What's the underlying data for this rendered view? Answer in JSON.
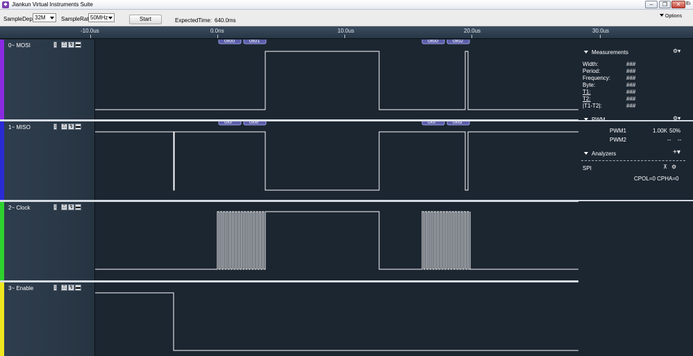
{
  "window": {
    "title": "Jiankun Virtual Instruments Suite",
    "edge_text": "Ei",
    "icon": "app-logo-icon",
    "minimize_glyph": "–",
    "restore_glyph": "❐",
    "close_glyph": "✕"
  },
  "toolbar": {
    "sample_depth_label": "SampleDepth",
    "sample_depth_value": "32M",
    "sample_rate_label": "SampleRate",
    "sample_rate_value": "50MHz",
    "start_label": "Start",
    "expected_time_label": "ExpectedTime:",
    "expected_time_value": "640.0ms",
    "options_label": "Options"
  },
  "ruler": {
    "labels": [
      "-10.0us",
      "0.0ns",
      "10.0us",
      "20.0us",
      "30.0us"
    ]
  },
  "channels": [
    {
      "name": "0~ MOSI",
      "color": "#8a2be2",
      "decodes": [
        "0x00",
        "0x01",
        "0x00",
        "0x02"
      ]
    },
    {
      "name": "1~ MISO",
      "color": "#2b2bd6",
      "decodes": [
        "0xff",
        "0xfe",
        "0xff",
        "0xfd"
      ]
    },
    {
      "name": "2~ Clock",
      "color": "#2fd12f",
      "decodes": []
    },
    {
      "name": "3~ Enable",
      "color": "#f0e620",
      "decodes": []
    }
  ],
  "channel_buttons": [
    "↕",
    "⎍",
    "↯",
    "▬"
  ],
  "measurements": {
    "title": "Measurements",
    "rows": [
      {
        "label": "Width:",
        "value": "###"
      },
      {
        "label": "Period:",
        "value": "###"
      },
      {
        "label": "Frequency:",
        "value": "###"
      },
      {
        "label": "Byte:",
        "value": "###"
      },
      {
        "label": "T1:",
        "value": "###"
      },
      {
        "label": "T2:",
        "value": "###"
      },
      {
        "label": "|T1-T2|:",
        "value": "###"
      }
    ]
  },
  "pwm": {
    "title": "PWM",
    "rows": [
      {
        "label": "PWM1",
        "freq": "1.00K",
        "duty": "50%"
      },
      {
        "label": "PWM2",
        "freq": "--",
        "duty": "--"
      }
    ]
  },
  "analyzers": {
    "title": "Analyzers",
    "add_glyph": "+",
    "items": [
      {
        "name": "SPI",
        "detail": "CPOL=0 CPHA=0"
      }
    ]
  }
}
